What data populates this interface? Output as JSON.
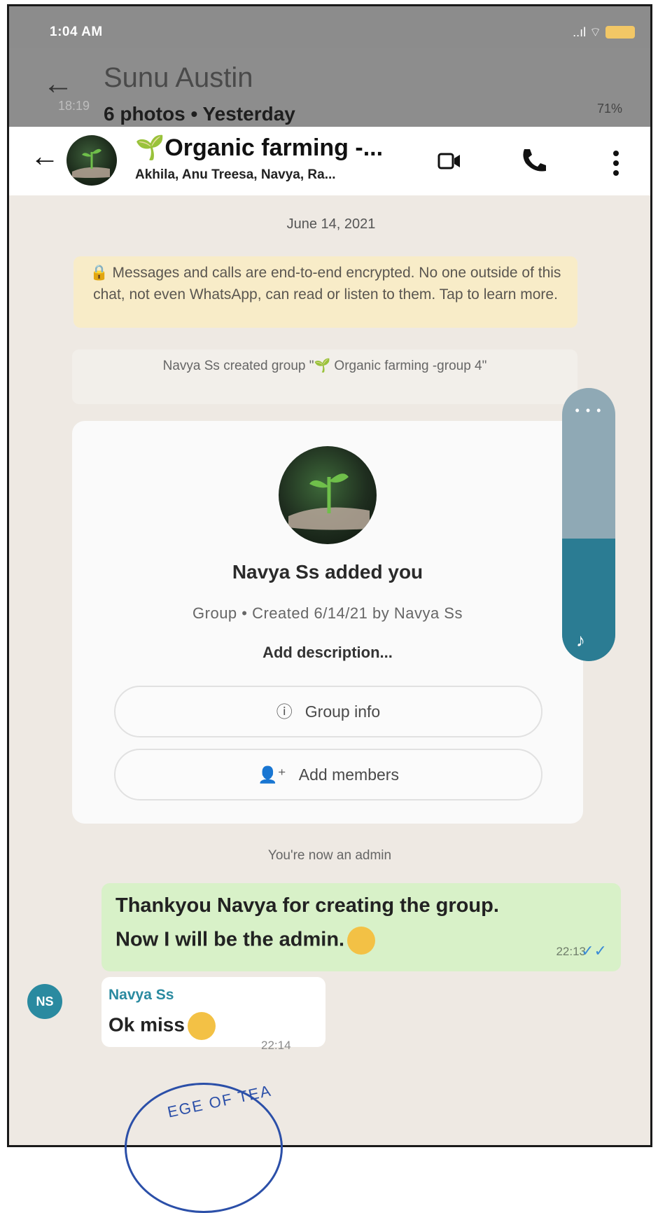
{
  "outer_status": {
    "time": "1:04 AM",
    "signal": "..ıl ⌔"
  },
  "viewer_header": {
    "title": "Sunu Austin",
    "subtitle": "6 photos • Yesterday",
    "inner_time": "18:19",
    "inner_battery": "71%"
  },
  "chat_header": {
    "title": "Organic farming -...",
    "members": "Akhila, Anu Treesa, Navya, Ra...",
    "icons": [
      "back-arrow-icon",
      "video-call-icon",
      "voice-call-icon",
      "more-options-icon"
    ]
  },
  "chat": {
    "date_chip": "June 14, 2021",
    "encryption_notice": "🔒 Messages and calls are end-to-end encrypted. No one outside of this chat, not even WhatsApp, can read or listen to them. Tap to learn more.",
    "created_notice": "Navya Ss created group \"🌱 Organic farming -group 4\"",
    "group_card": {
      "title": "Navya Ss added you",
      "subtitle": "Group • Created 6/14/21 by Navya Ss",
      "description_link": "Add description...",
      "group_info_label": "Group info",
      "add_members_label": "Add members"
    },
    "admin_notice": "You're now an admin",
    "outgoing": {
      "line1": "Thankyou Navya for creating the group.",
      "line2": "Now I will be the admin.",
      "time": "22:13"
    },
    "incoming": {
      "avatar_initials": "NS",
      "sender": "Navya Ss",
      "text": "Ok miss",
      "time": "22:14"
    }
  },
  "volume_overlay": {
    "level": 0.45
  },
  "stamp": {
    "text": "EGE OF TEA"
  },
  "colors": {
    "outgoing_bubble": "#d8f1c8",
    "encryption_bg": "#f8ecc8",
    "volume_fill": "#2b7c93",
    "sender_color": "#2a8aa0"
  }
}
